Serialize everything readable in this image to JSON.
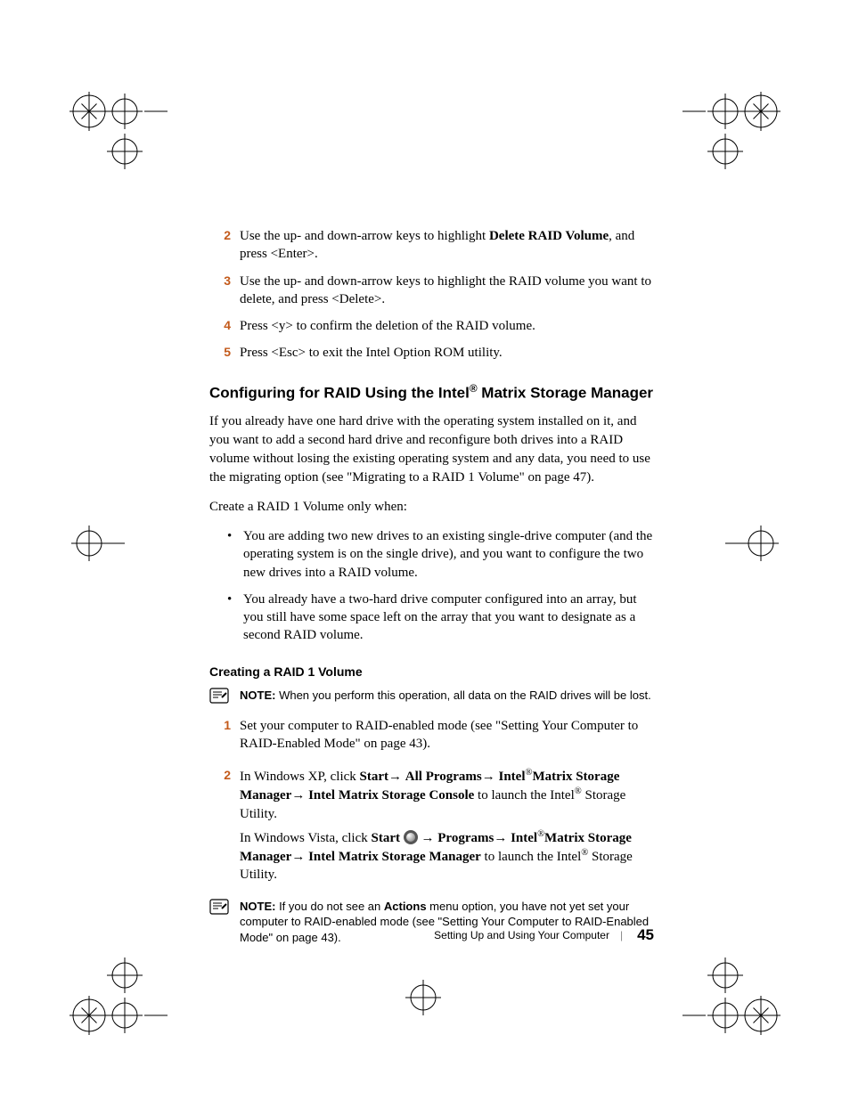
{
  "steps_top": [
    {
      "num": "2",
      "html": "Use the up- and down-arrow keys to highlight <span class='b'>Delete RAID Volume</span>, and press &lt;Enter&gt;."
    },
    {
      "num": "3",
      "html": "Use the up- and down-arrow keys to highlight the RAID volume you want to delete, and press &lt;Delete&gt;."
    },
    {
      "num": "4",
      "html": "Press &lt;y&gt; to confirm the deletion of the RAID volume."
    },
    {
      "num": "5",
      "html": "Press &lt;Esc&gt; to exit the Intel Option ROM utility."
    }
  ],
  "h3": "Configuring for RAID Using the Intel<sup class='reg'>®</sup> Matrix Storage Manager",
  "para1": "If you already have one hard drive with the operating system installed on it, and you want to add a second hard drive and reconfigure both drives into a RAID volume without losing the existing operating system and any data, you need to use the migrating option (see \"Migrating to a RAID 1 Volume\" on page 47).",
  "para2": "Create a RAID 1 Volume only when:",
  "bullets": [
    "You are adding two new drives to an existing single-drive computer (and the operating system is on the single drive), and you want to configure the two new drives into a RAID volume.",
    "You already have a two-hard drive computer configured into an array, but you still have some space left on the array that you want to designate as a second RAID volume."
  ],
  "h4": "Creating a RAID 1 Volume",
  "note1_label": "NOTE:",
  "note1_text": " When you perform this operation, all data on the RAID drives will be lost.",
  "steps_bottom": [
    {
      "num": "1",
      "paras": [
        "Set your computer to RAID-enabled mode (see \"Setting Your Computer to RAID-Enabled Mode\" on page 43)."
      ]
    },
    {
      "num": "2",
      "paras": [
        "In Windows XP, click <span class='b'>Start</span><span class='arrow'>→</span> <span class='b'>All Programs</span><span class='arrow'>→</span> <span class='b'>Intel</span><sup class='reg'>®</sup><span class='b'>Matrix Storage Manager</span><span class='arrow'>→</span> <span class='b'>Intel Matrix Storage Console</span> to launch the Intel<sup class='reg'>®</sup> Storage Utility.",
        "In Windows Vista, click <span class='b'>Start</span> <span class='vista-circle' data-name='windows-start-icon' data-interactable='false'></span> <span class='arrow'>→</span> <span class='b'>Programs</span><span class='arrow'>→</span> <span class='b'>Intel</span><sup class='reg'>®</sup><span class='b'>Matrix Storage Manager</span><span class='arrow'>→</span> <span class='b'>Intel Matrix Storage Manager</span> to launch the Intel<sup class='reg'>®</sup> Storage Utility."
      ]
    }
  ],
  "note2_label": "NOTE:",
  "note2_text": " If you do not see an <span class='b'>Actions</span> menu option, you have not yet set your computer to RAID-enabled mode (see \"Setting Your Computer to RAID-Enabled Mode\" on page 43).",
  "footer_text": "Setting Up and Using Your Computer",
  "footer_page": "45"
}
